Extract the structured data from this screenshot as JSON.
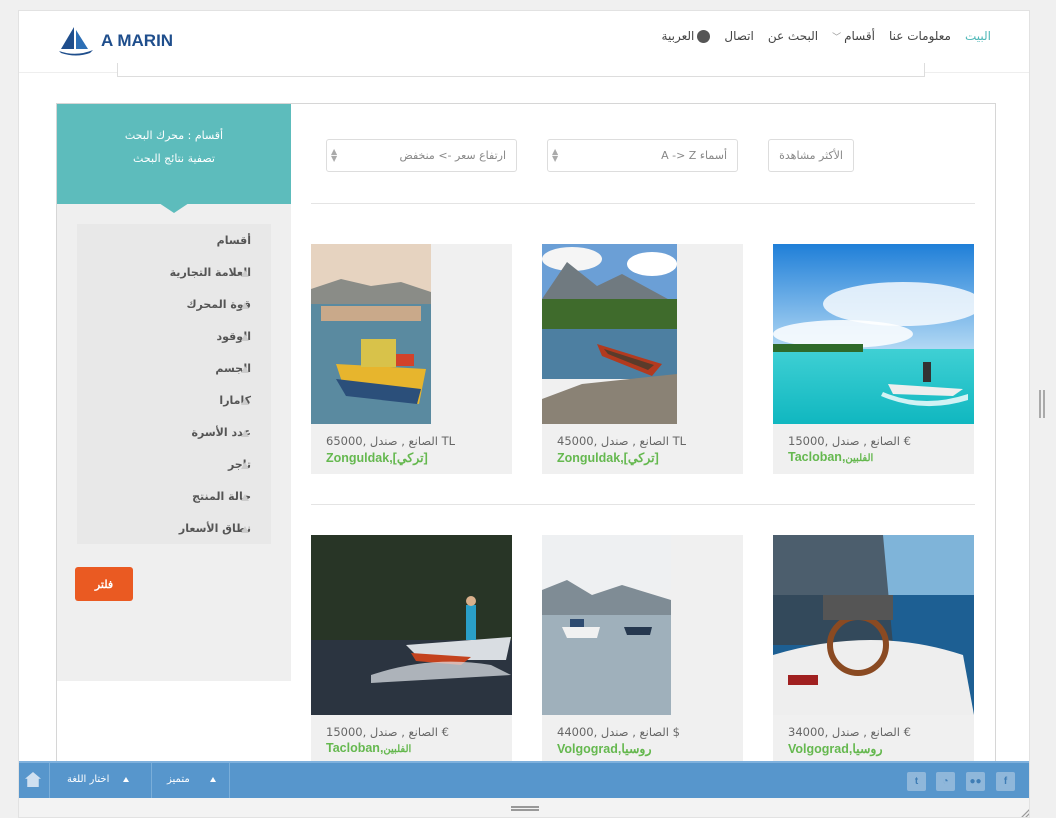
{
  "header": {
    "logo_text": "A MARIN",
    "nav": [
      {
        "label": "البيت",
        "active": true
      },
      {
        "label": "معلومات عنا",
        "active": false
      },
      {
        "label": "أقسام",
        "active": false,
        "dropdown": true
      },
      {
        "label": "البحث عن",
        "active": false
      },
      {
        "label": "اتصال",
        "active": false
      },
      {
        "label": "العربية",
        "active": false,
        "icon": "globe-icon"
      }
    ]
  },
  "sidebar": {
    "title_line1": "أقسام : محرك البحث",
    "title_line2": "تصفية نتائج البحث",
    "filters": [
      "أقسام",
      "العلامة التجارية",
      "قوة المحرك",
      "الوقود",
      "الجسم",
      "كامارا",
      "عدد الأسرة",
      "تاجر",
      "حالة المنتج",
      "نطاق الأسعار"
    ],
    "filter_button": "فلتر",
    "accent_color": "#5dbcbc",
    "button_color": "#ea5a22"
  },
  "sorting": {
    "most_viewed": "الأكثر مشاهدة",
    "names": "أسماء A -> Z",
    "price": "ارتفاع سعر -> منخفض"
  },
  "listings": [
    {
      "price": "15000, الصانع , صندل €",
      "city": "Tacloban,",
      "country": "الفلبين"
    },
    {
      "price": "45000, الصانع , صندل TL",
      "city": "Zonguldak,",
      "country": "[تركي]"
    },
    {
      "price": "65000, الصانع , صندل TL",
      "city": "Zonguldak,",
      "country": "[تركي]"
    },
    {
      "price": "34000, الصانع , صندل €",
      "city": "Volgograd,",
      "country": "روسيا"
    },
    {
      "price": "44000, الصانع , صندل $",
      "city": "Volgograd,",
      "country": "روسيا"
    },
    {
      "price": "15000, الصانع , صندل €",
      "city": "Tacloban,",
      "country": "الفلبين"
    }
  ],
  "bottombar": {
    "language": "اختار اللغة",
    "featured": "متميز",
    "social": [
      "f",
      "flickr",
      "rss",
      "t"
    ],
    "color": "#5796cc"
  }
}
